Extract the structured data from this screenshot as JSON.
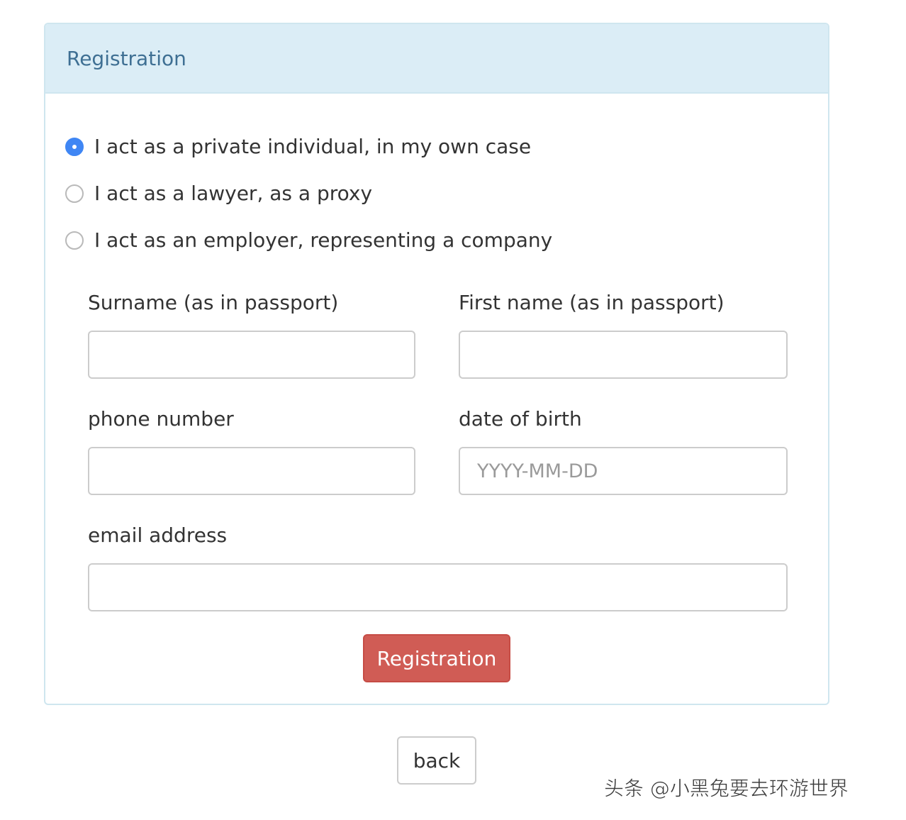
{
  "panel": {
    "title": "Registration"
  },
  "role_options": [
    {
      "label": "I act as a private individual, in my own case",
      "checked": true
    },
    {
      "label": "I act as a lawyer, as a proxy",
      "checked": false
    },
    {
      "label": "I act as an employer, representing a company",
      "checked": false
    }
  ],
  "form": {
    "surname": {
      "label": "Surname (as in passport)",
      "value": "",
      "placeholder": ""
    },
    "first_name": {
      "label": "First name (as in passport)",
      "value": "",
      "placeholder": ""
    },
    "phone": {
      "label": "phone number",
      "value": "",
      "placeholder": ""
    },
    "dob": {
      "label": "date of birth",
      "value": "",
      "placeholder": "YYYY-MM-DD"
    },
    "email": {
      "label": "email address",
      "value": "",
      "placeholder": ""
    }
  },
  "buttons": {
    "register_label": "Registration",
    "back_label": "back"
  },
  "watermark": {
    "text": "头条 @小黑兔要去环游世界"
  },
  "colors": {
    "heading_bg": "#dbedf6",
    "heading_text": "#3e6f93",
    "radio_checked": "#3f86f4",
    "register_button": "#d05c55"
  }
}
